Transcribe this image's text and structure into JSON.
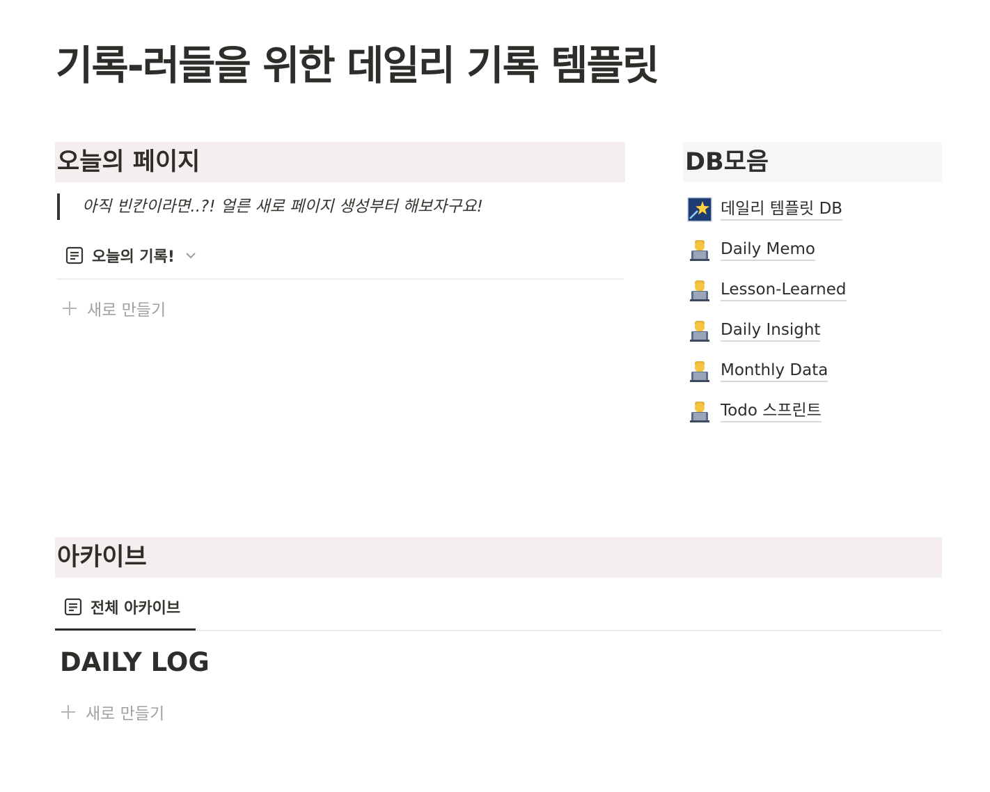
{
  "page": {
    "title": "기록-러들을 위한 데일리 기록 템플릿"
  },
  "today_section": {
    "heading": "오늘의 페이지",
    "callout": "아직 빈칸이라면..?! 얼른 새로 페이지 생성부터 해보자구요!",
    "view_tab_label": "오늘의 기록!",
    "view_tab_icon": "document-icon",
    "new_button_label": "새로 만들기"
  },
  "db_section": {
    "heading": "DB모음",
    "items": [
      {
        "label": "데일리 템플릿 DB",
        "icon": "shooting-star-icon"
      },
      {
        "label": "Daily Memo",
        "icon": "technologist-icon"
      },
      {
        "label": "Lesson-Learned",
        "icon": "technologist-icon"
      },
      {
        "label": "Daily Insight",
        "icon": "technologist-icon"
      },
      {
        "label": "Monthly Data",
        "icon": "technologist-icon"
      },
      {
        "label": "Todo 스프린트",
        "icon": "technologist-icon"
      }
    ]
  },
  "archive_section": {
    "heading": "아카이브",
    "view_tab_label": "전체 아카이브",
    "group_title": "DAILY LOG",
    "new_button_label": "새로 만들기"
  },
  "colors": {
    "heading_bg": "#f4efee",
    "db_heading_bg": "#f6f5f8",
    "text": "#37352f",
    "muted": "#a3a19d"
  }
}
